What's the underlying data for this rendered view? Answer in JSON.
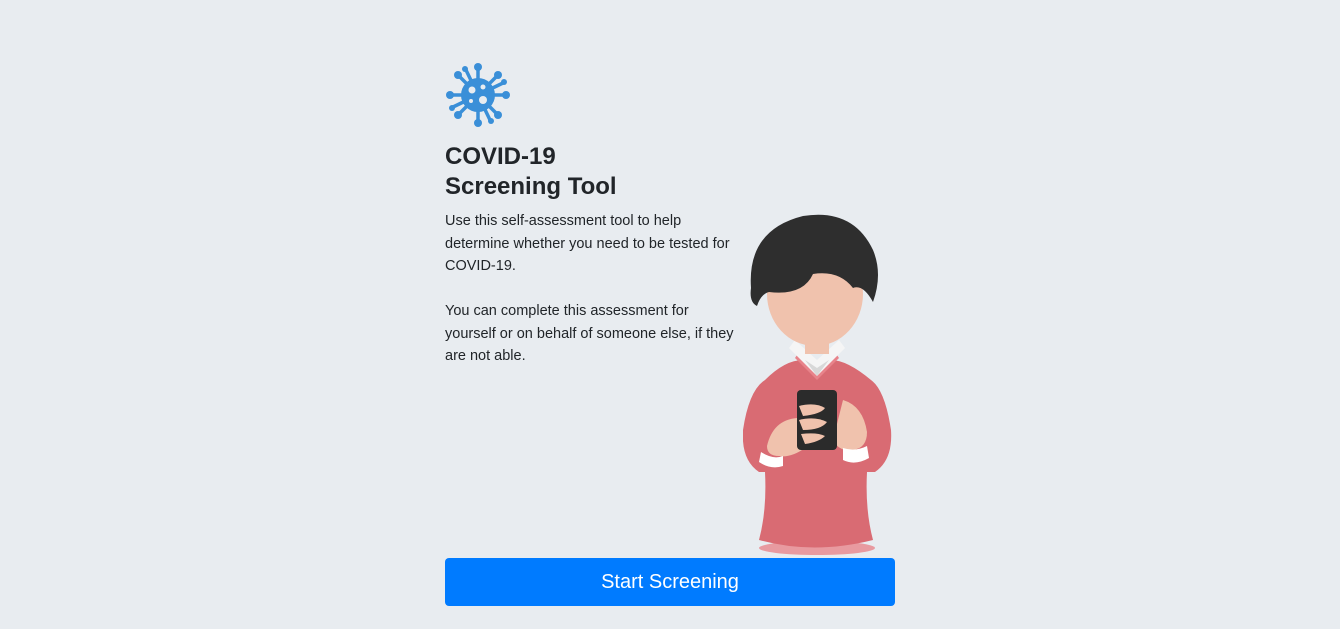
{
  "header": {
    "icon": "virus-icon",
    "title_line1": "COVID-19",
    "title_line2": "Screening Tool"
  },
  "intro": {
    "paragraph1": "Use this self-assessment tool to help determine whether you need to be tested for COVID-19.",
    "paragraph2": "You can complete this assessment for yourself or on behalf of someone else, if they are not able."
  },
  "illustration": {
    "icon": "person-with-phone-illustration"
  },
  "actions": {
    "start_label": "Start Screening"
  },
  "colors": {
    "background": "#e8ecf0",
    "accent": "#007bff",
    "icon_blue": "#3a8fd8",
    "sweater": "#d96b73"
  }
}
